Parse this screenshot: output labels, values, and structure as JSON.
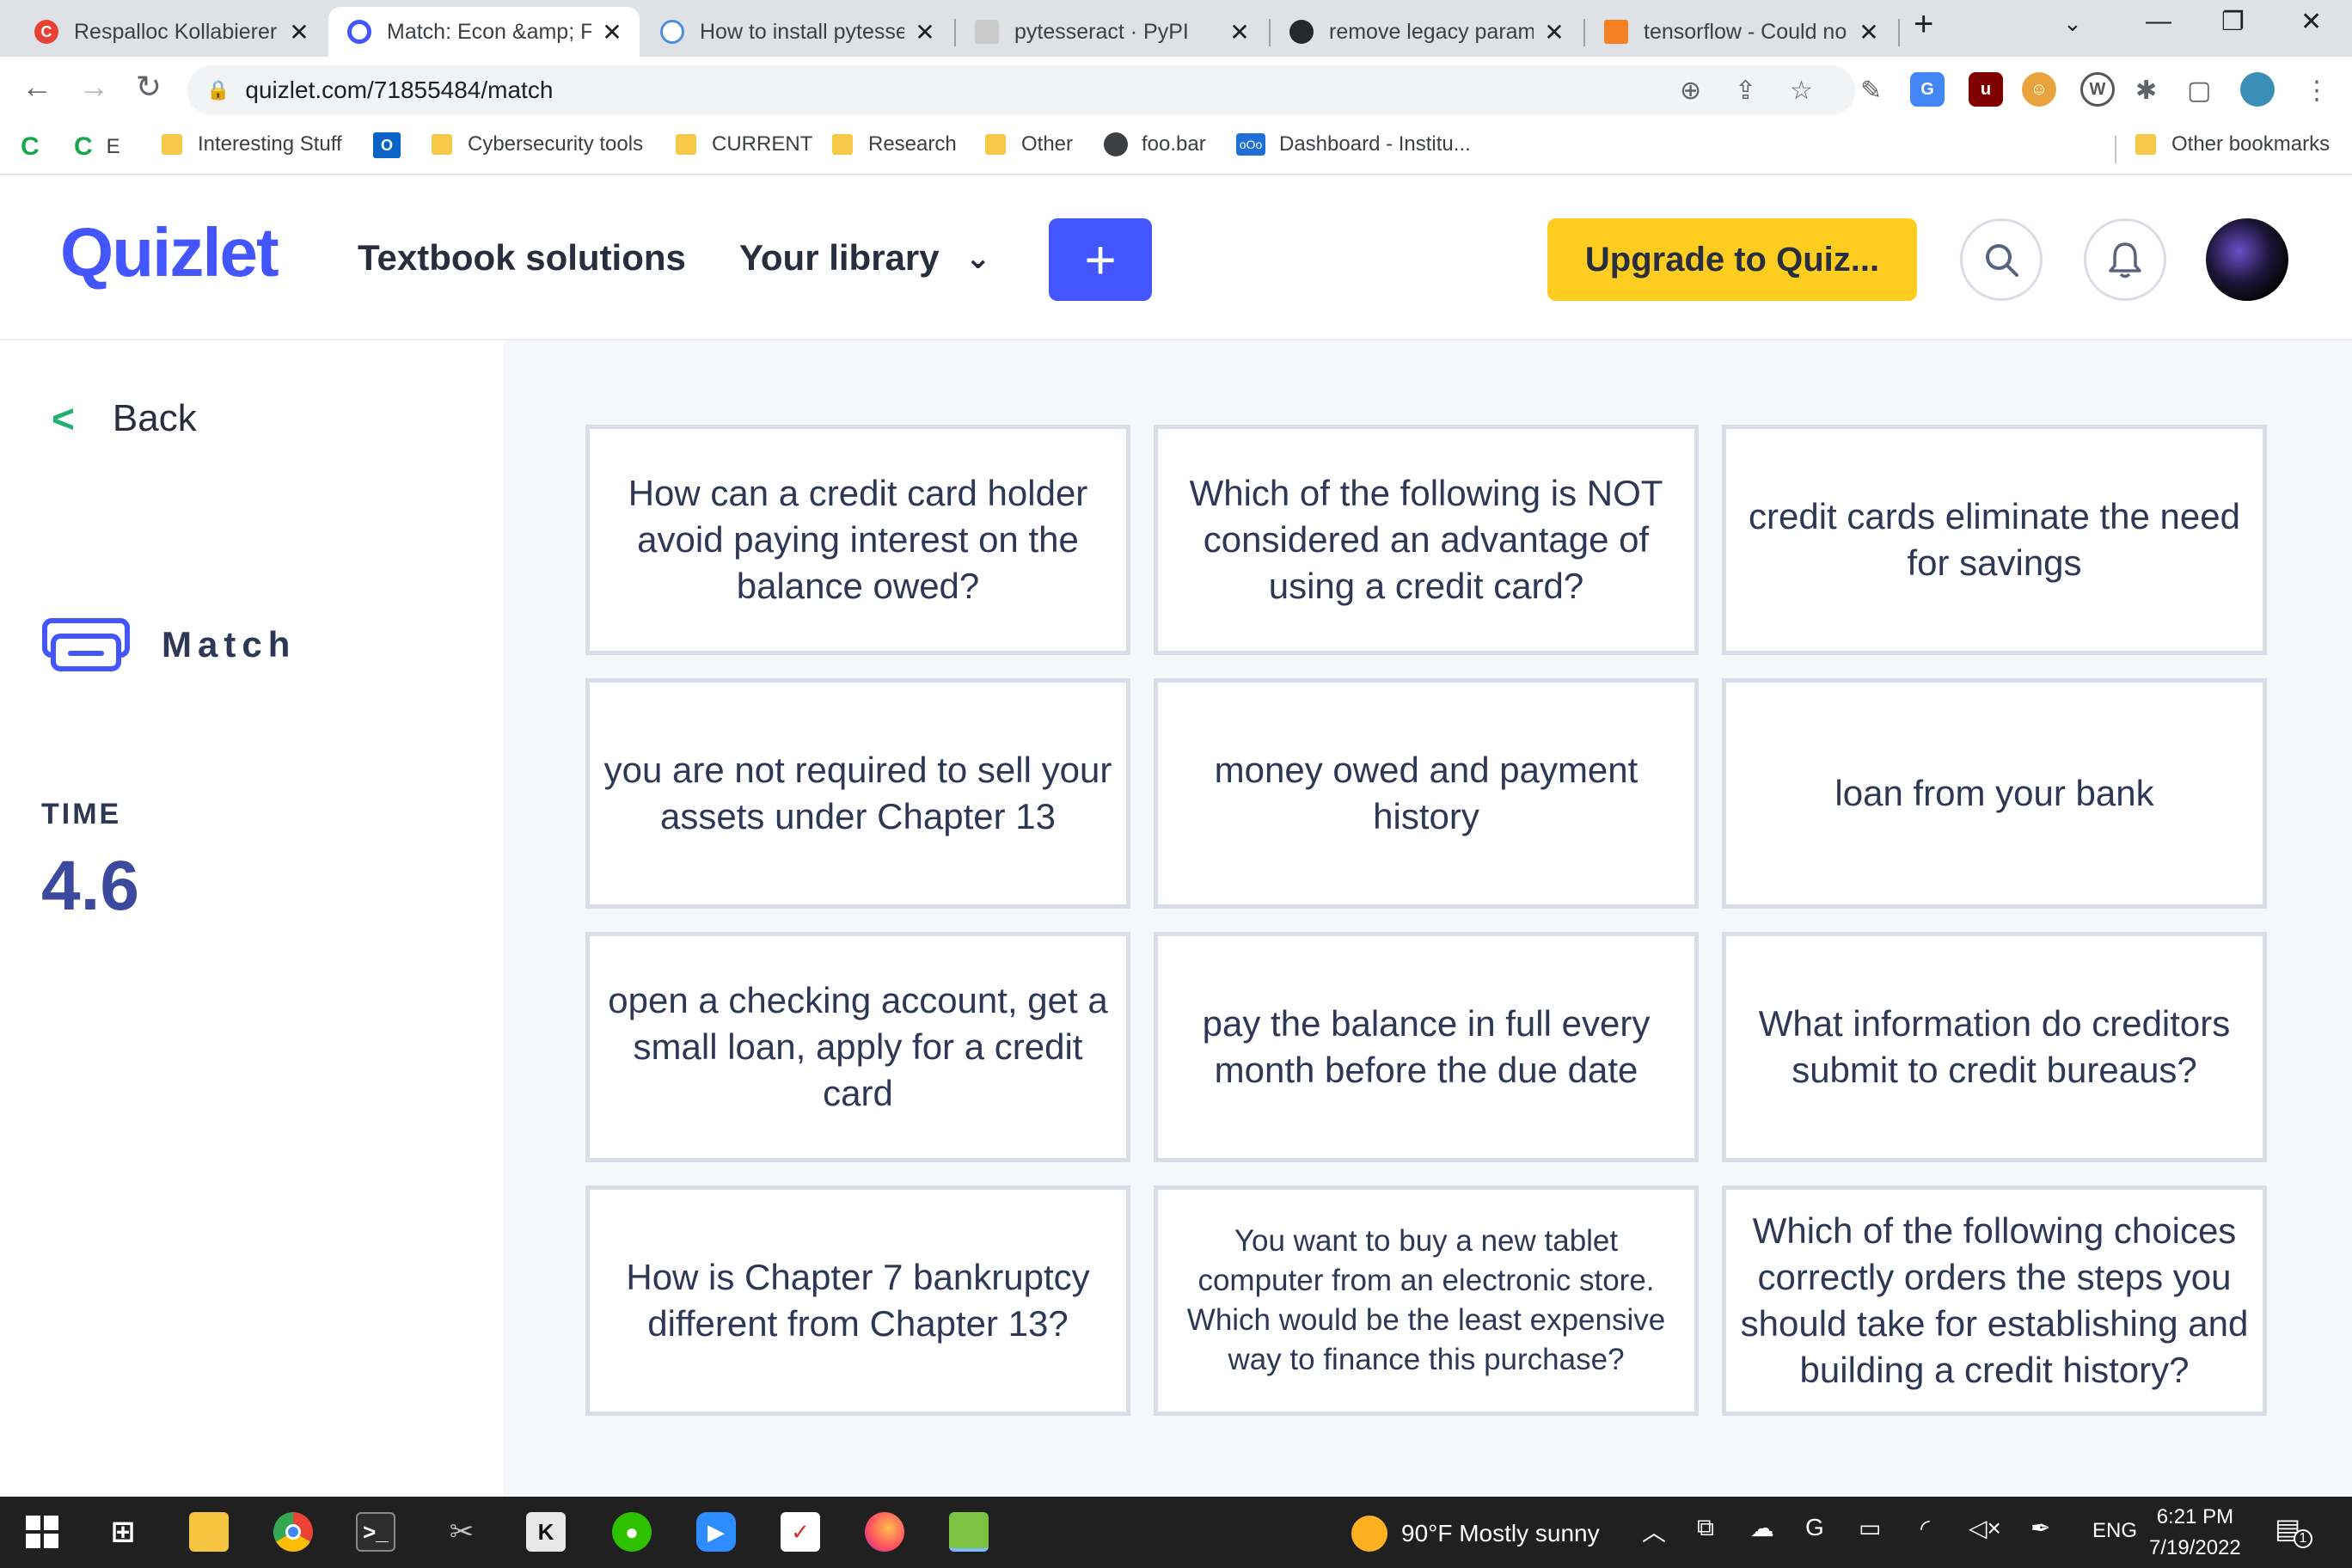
{
  "browser": {
    "tabs": [
      {
        "title": "Respalloc Kollabierer",
        "active": false,
        "favicon_color": "#e94235"
      },
      {
        "title": "Match: Econ &amp; Fi",
        "active": true,
        "favicon_color": "#4255ff"
      },
      {
        "title": "How to install pytesse",
        "active": false,
        "favicon_color": "#4e8fd8"
      },
      {
        "title": "pytesseract · PyPI",
        "active": false,
        "favicon_color": "#c9c9c9"
      },
      {
        "title": "remove legacy parame",
        "active": false,
        "favicon_color": "#24292f"
      },
      {
        "title": "tensorflow - Could no",
        "active": false,
        "favicon_color": "#f48024"
      }
    ],
    "new_tab_icon": "plus-icon",
    "url": "quizlet.com/71855484/match",
    "bookmarks": [
      {
        "label": "E",
        "icon": "c-logo-icon"
      },
      {
        "label": "Interesting Stuff",
        "icon": "folder-icon"
      },
      {
        "label": "",
        "icon": "outlook-icon"
      },
      {
        "label": "Cybersecurity tools",
        "icon": "folder-icon"
      },
      {
        "label": "CURRENT",
        "icon": "folder-icon"
      },
      {
        "label": "Research",
        "icon": "folder-icon"
      },
      {
        "label": "Other",
        "icon": "folder-icon"
      },
      {
        "label": "foo.bar",
        "icon": "globe-icon"
      },
      {
        "label": "Dashboard - Institu...",
        "icon": "nextcloud-icon"
      }
    ],
    "other_bookmarks": "Other bookmarks"
  },
  "header": {
    "logo": "Quizlet",
    "textbook_solutions": "Textbook solutions",
    "your_library": "Your library",
    "create_symbol": "+",
    "upgrade": "Upgrade to Quiz..."
  },
  "sidebar": {
    "back": "Back",
    "mode": "Match",
    "time_label": "TIME",
    "time_value": "4.6"
  },
  "cards": [
    "How can a credit card holder avoid paying interest on the balance owed?",
    "Which of the following is NOT considered an advantage of using a credit card?",
    "credit cards eliminate the need for savings",
    "you are not required to sell your assets under Chapter 13",
    "money owed and payment history",
    "loan from your bank",
    "open a checking account, get a small loan, apply for a credit card",
    "pay the balance in full every month before the due date",
    "What information do creditors submit to credit bureaus?",
    "How is Chapter 7 bankruptcy different from Chapter 13?",
    "You want to buy a new tablet computer from an electronic store. Which would be the least expensive way to finance this purchase?",
    "Which of the following choices correctly orders the steps you should take for establishing and building a credit history?"
  ],
  "taskbar": {
    "weather": "90°F  Mostly sunny",
    "language": "ENG",
    "time": "6:21 PM",
    "date": "7/19/2022",
    "notification_count": "1"
  },
  "colors": {
    "quizlet_blue": "#4255ff",
    "upgrade_yellow": "#ffcd1f",
    "back_chevron": "#23b26d",
    "card_border": "#d9dde8",
    "main_bg": "#f6f7fb"
  }
}
